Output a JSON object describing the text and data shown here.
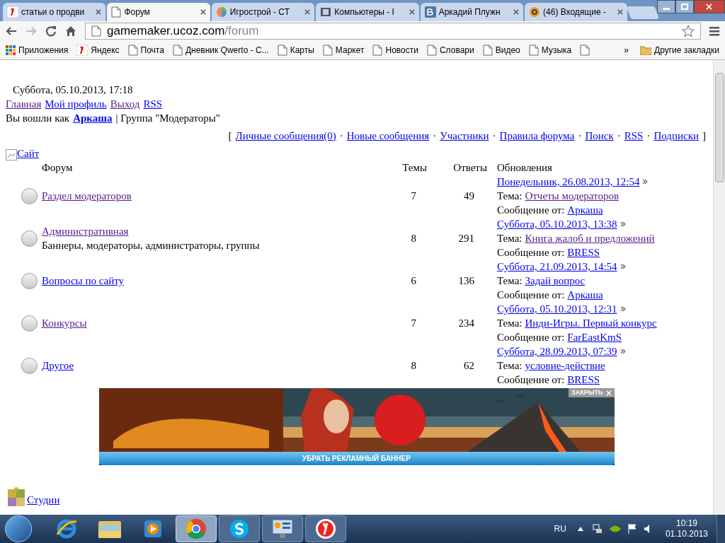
{
  "tabs": [
    {
      "title": "статьи о продви",
      "selected": false
    },
    {
      "title": "Форум",
      "selected": true
    },
    {
      "title": "Игрострой - СТ",
      "selected": false
    },
    {
      "title": "Компьютеры - І",
      "selected": false
    },
    {
      "title": "Аркадий Плужн",
      "selected": false
    },
    {
      "title": "(46) Входящие -",
      "selected": false
    }
  ],
  "address": {
    "host": "gamemaker.ucoz.com",
    "path": "/forum"
  },
  "bookmarks": [
    "Приложения",
    "Яндекс",
    "Почта",
    "Дневник Qwerto - С...",
    "Карты",
    "Маркет",
    "Новости",
    "Словари",
    "Видео",
    "Музыка"
  ],
  "bookmarks_more": "»",
  "other_bookmarks": "Другие закладки",
  "page": {
    "date": "Суббота, 05.10.2013, 17:18",
    "top_links": [
      {
        "text": "Главная",
        "visited": true
      },
      {
        "text": "Мой профиль",
        "visited": false
      },
      {
        "text": "Выход",
        "visited": true
      },
      {
        "text": "RSS",
        "visited": false
      }
    ],
    "login_prefix": "Вы вошли как",
    "login_user": "Аркаша",
    "login_group": "| Группа \"Модераторы\"",
    "nav_open": "[",
    "nav_links": [
      "Личные сообщения(0)",
      "Новые сообщения",
      "Участники",
      "Правила форума",
      "Поиск",
      "RSS",
      "Подписки"
    ],
    "nav_sep": "·",
    "nav_close": "]",
    "section": "Сайт",
    "columns": [
      "Форум",
      "Темы",
      "Ответы",
      "Обновления"
    ],
    "forums": [
      {
        "name": "Раздел модераторов",
        "visited": true,
        "topics": "7",
        "replies": "49",
        "date": "Понедельник, 26.08.2013, 12:54",
        "topic_label": "Тема:",
        "topic": "Отчеты модераторов",
        "topic_visited": true,
        "from_label": "Сообщение от:",
        "author": "Аркаша"
      },
      {
        "name": "Административная",
        "visited": true,
        "description": "Баннеры, модераторы, администраторы, группы",
        "topics": "8",
        "replies": "291",
        "date": "Суббота, 05.10.2013, 13:38",
        "topic_label": "Тема:",
        "topic": "Книга жалоб и предложений",
        "topic_visited": true,
        "from_label": "Сообщение от:",
        "author": "BRESS"
      },
      {
        "name": "Вопросы по сайту",
        "visited": false,
        "topics": "6",
        "replies": "136",
        "date": "Суббота, 21.09.2013, 14:54",
        "topic_label": "Тема:",
        "topic": "Задай вопрос",
        "topic_visited": false,
        "from_label": "Сообщение от:",
        "author": "Аркаша"
      },
      {
        "name": "Конкурсы",
        "visited": true,
        "topics": "7",
        "replies": "234",
        "date": "Суббота, 05.10.2013, 12:31",
        "topic_label": "Тема:",
        "topic": "Инди-Игры. Первый конкурс",
        "topic_visited": false,
        "from_label": "Сообщение от:",
        "author": "FarEastKmS"
      },
      {
        "name": "Другое",
        "visited": false,
        "topics": "8",
        "replies": "62",
        "date": "Суббота, 28.09.2013, 07:39",
        "topic_label": "Тема:",
        "topic": "условие-действие",
        "topic_visited": false,
        "from_label": "Сообщение от:",
        "author": "BRESS"
      }
    ],
    "banner": {
      "close": "ЗАКРЫТЬ",
      "remove": "УБРАТЬ РЕКЛАМНЫЙ БАННЕР"
    },
    "section2": "Студии"
  },
  "taskbar": {
    "apps": [
      {
        "kind": "ie",
        "selected": false
      },
      {
        "kind": "explorer",
        "selected": false
      },
      {
        "kind": "media",
        "selected": false
      },
      {
        "kind": "chrome",
        "selected": true
      },
      {
        "kind": "skype",
        "selected": false
      },
      {
        "kind": "control",
        "selected": false
      },
      {
        "kind": "yandex",
        "selected": false
      }
    ],
    "lang": "RU",
    "time": "10:19",
    "date": "01.10.2013"
  }
}
